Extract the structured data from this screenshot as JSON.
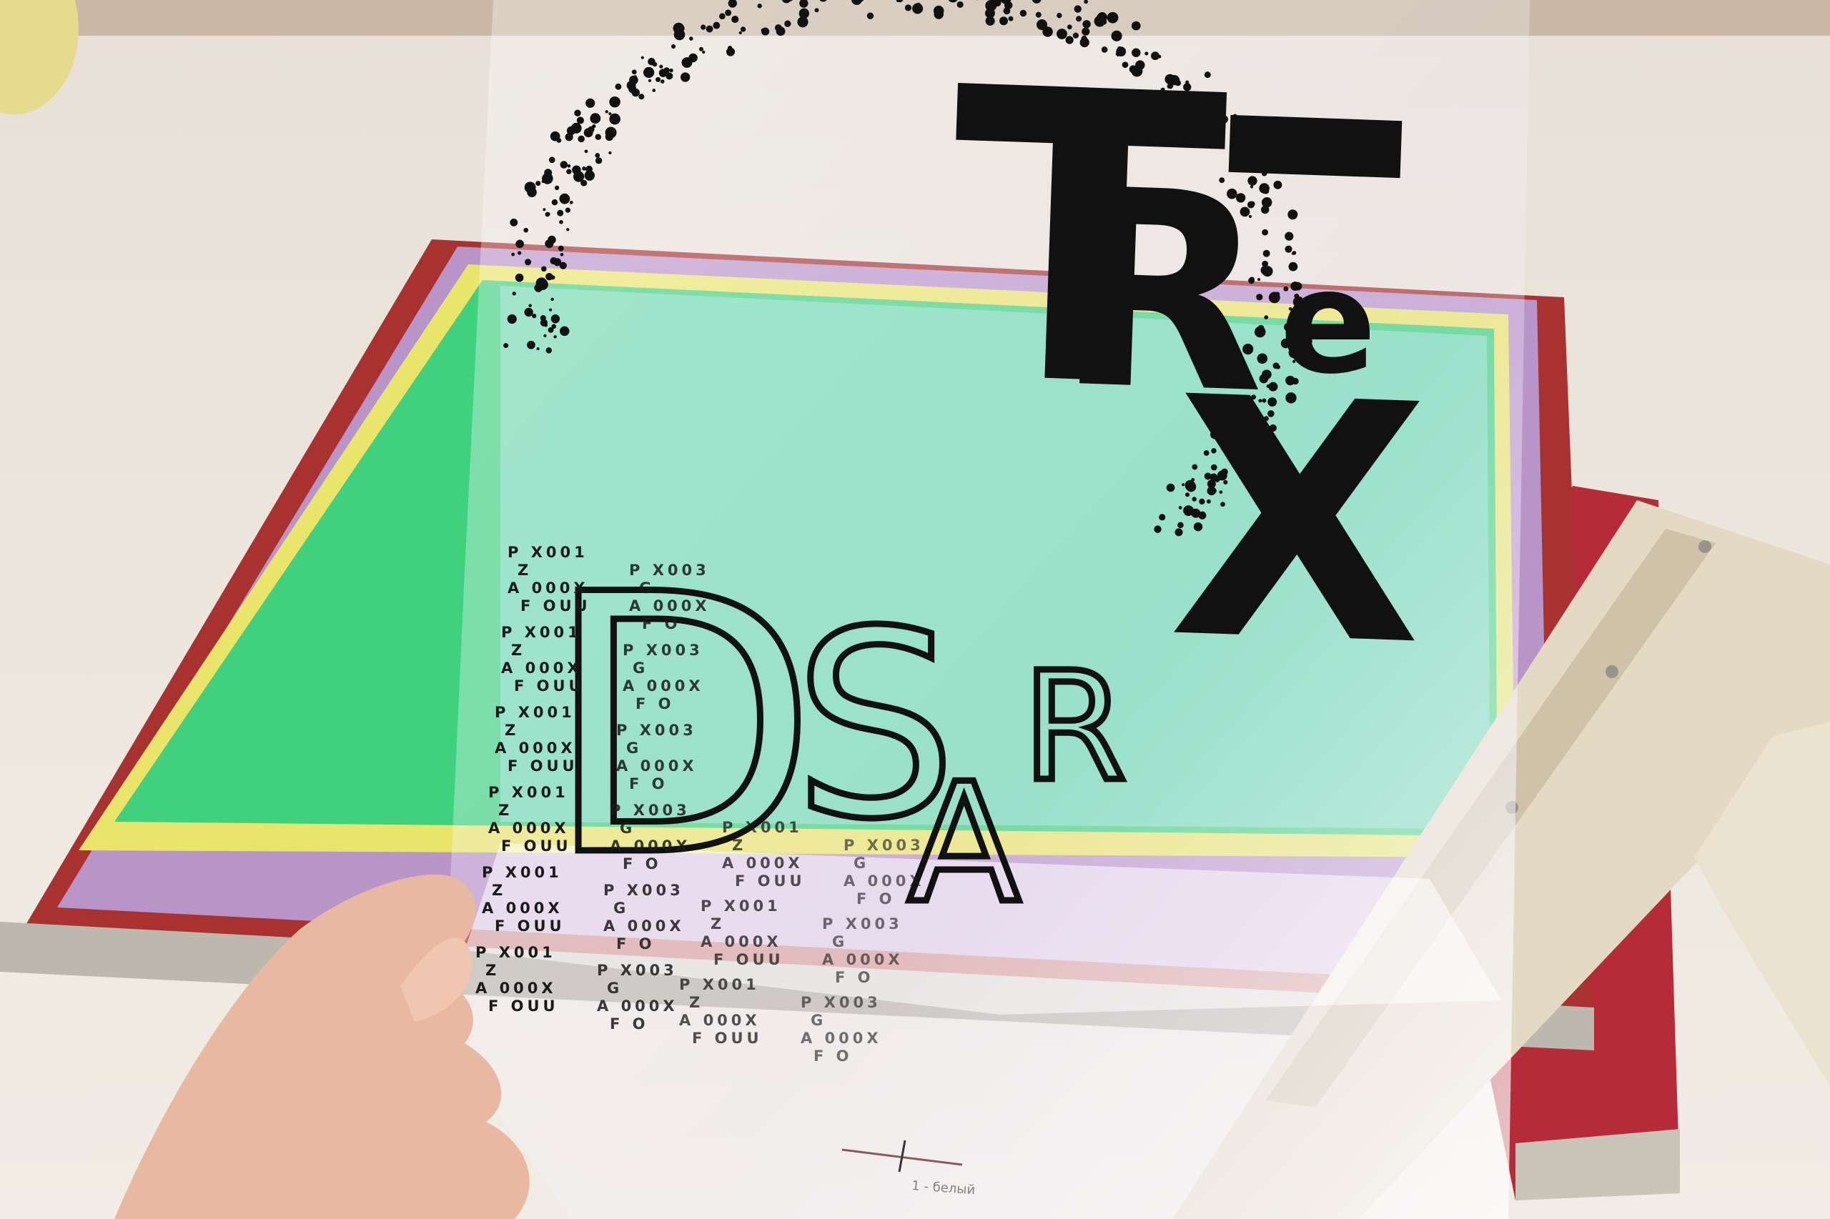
{
  "photo": {
    "subject": "Screen printing transparency film held over a screen frame"
  },
  "artwork": {
    "headline": {
      "t": "T",
      "r": "R",
      "e": "e",
      "x": "X"
    },
    "outline_letters": {
      "d": "D",
      "s": "S",
      "a": "A",
      "r": "R"
    },
    "code_tile_a": {
      "l1": "P X001",
      "l2": "Z",
      "l3": "A 000X",
      "l4": "F OUU"
    },
    "code_tile_b": {
      "l1": "P X003",
      "l2": "G",
      "l3": "A 000X",
      "l4": "F O"
    },
    "registration_label": "1 - белый"
  },
  "colors": {
    "background": "#ece6dc",
    "frame": "#a8322f",
    "emulsion": "#3fd17e",
    "emulsion_tint": "#7fdcc0",
    "border_yellow": "#e9e56a",
    "purple": "#b994c8",
    "squeegee": "#e4d9c3",
    "skin": "#e9b8a0"
  }
}
